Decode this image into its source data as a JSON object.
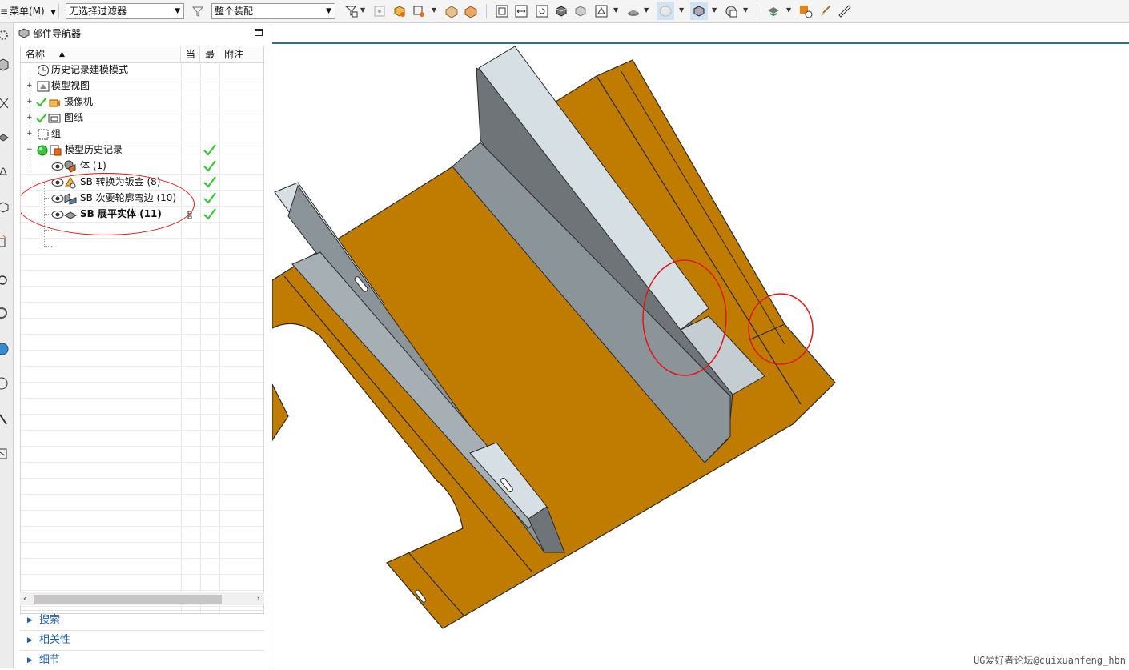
{
  "toolbar": {
    "menu_label": "菜单(M)",
    "selection_filter": "无选择过滤器",
    "assembly_scope": "整个装配"
  },
  "navigator": {
    "title": "部件导航器",
    "columns": {
      "name": "名称",
      "current": "当",
      "latest": "最",
      "comment": "附注"
    },
    "rows": [
      {
        "label": "历史记录建模模式",
        "checked_latest": false
      },
      {
        "label": "模型视图",
        "checked_latest": false
      },
      {
        "label": "摄像机",
        "checked_latest": false
      },
      {
        "label": "图纸",
        "checked_latest": false
      },
      {
        "label": "组",
        "checked_latest": false
      },
      {
        "label": "模型历史记录",
        "checked_latest": true
      },
      {
        "label": "体 (1)",
        "checked_latest": true
      },
      {
        "label": "SB 转换为钣金 (8)",
        "checked_latest": true
      },
      {
        "label": "SB 次要轮廓弯边 (10)",
        "checked_latest": true
      },
      {
        "label": "SB 展平实体 (11)",
        "checked_latest": true
      }
    ],
    "sections": [
      "搜索",
      "相关性",
      "细节"
    ]
  },
  "viewport": {
    "watermark": "UG爱好者论坛@cuixuanfeng_hbn"
  },
  "colors": {
    "sheet_metal": "#c07c00",
    "flange_light": "#d6e0e4",
    "flange_dark": "#7b8387",
    "annotation_red": "#e01818",
    "check_green": "#2ec52e",
    "link_blue": "#1f5fa6"
  }
}
